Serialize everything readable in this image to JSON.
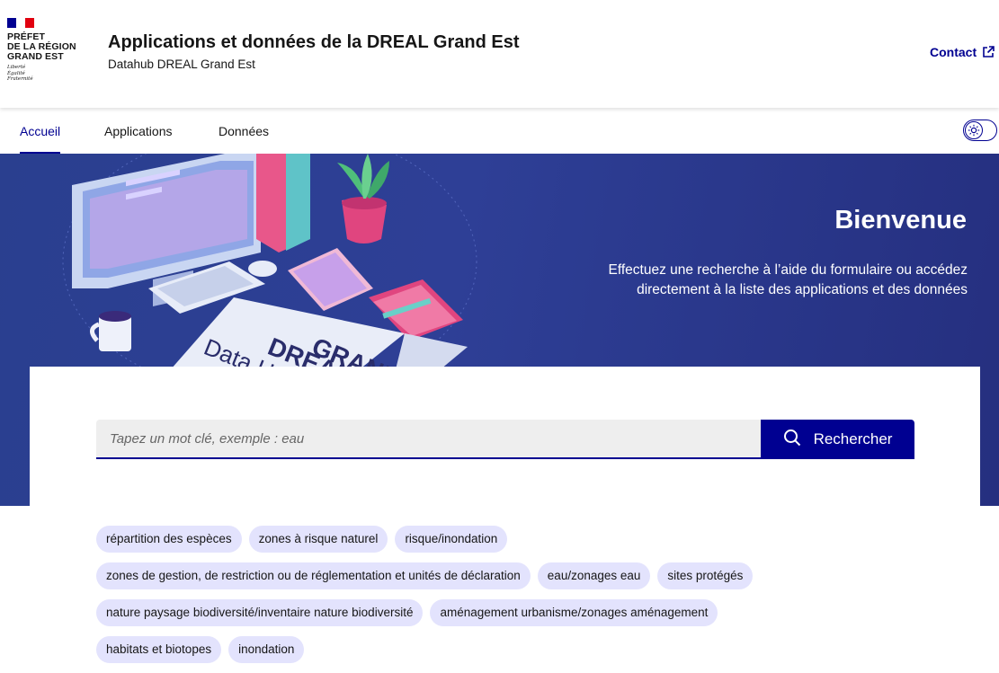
{
  "brand": {
    "flag_colors": [
      "#000091",
      "#ffffff",
      "#e1000f"
    ],
    "logo_lines": [
      "PRÉFET",
      "DE LA RÉGION",
      "GRAND EST"
    ],
    "motto_lines": [
      "Liberté",
      "Égalité",
      "Fraternité"
    ]
  },
  "header": {
    "title": "Applications et données de la DREAL Grand Est",
    "tagline": "Datahub DREAL Grand Est",
    "contact_label": "Contact",
    "contact_icon": "external-link-icon"
  },
  "nav": {
    "items": [
      {
        "label": "Accueil",
        "active": true
      },
      {
        "label": "Applications",
        "active": false
      },
      {
        "label": "Données",
        "active": false
      }
    ],
    "theme_toggle_icon": "sun-icon"
  },
  "hero": {
    "title": "Bienvenue",
    "text": "Effectuez une recherche à l’aide du formulaire ou accédez directement à la liste des applications et des données",
    "illustration_text": [
      "Data Hub",
      "DREAL",
      "GRAND EST"
    ]
  },
  "search": {
    "placeholder": "Tapez un mot clé, exemple : eau",
    "value": "",
    "button_label": "Rechercher",
    "button_icon": "search-icon"
  },
  "tags": [
    [
      "répartition des espèces",
      "zones à risque naturel",
      "risque/inondation"
    ],
    [
      "zones de gestion, de restriction ou de réglementation et unités de déclaration",
      "eau/zonages eau",
      "sites protégés"
    ],
    [
      "nature paysage biodiversité/inventaire nature biodiversité",
      "aménagement urbanisme/zonages aménagement"
    ],
    [
      "habitats et biotopes",
      "inondation"
    ]
  ],
  "colors": {
    "primary": "#000091",
    "hero_bg": "#2e3f96",
    "tag_bg": "#e3e3fd",
    "field_bg": "#eeeeee"
  }
}
